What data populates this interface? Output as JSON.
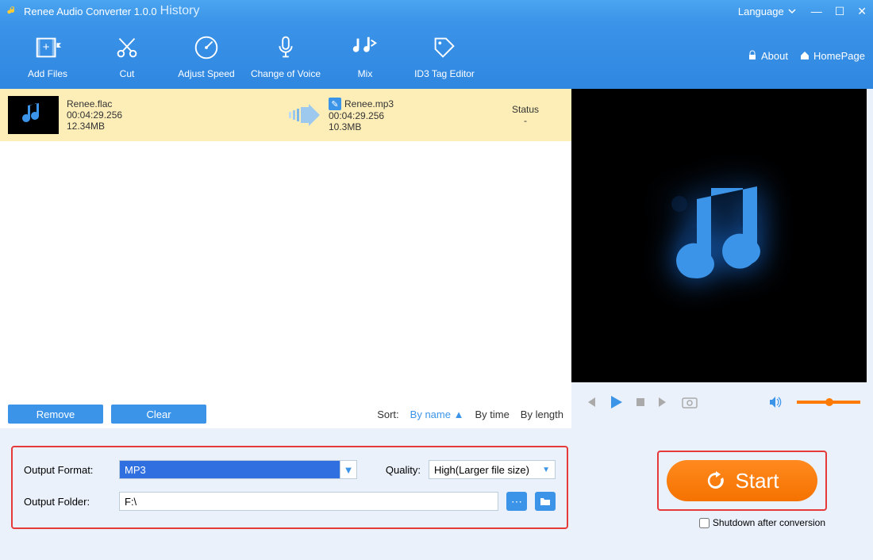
{
  "titlebar": {
    "app_title": "Renee Audio Converter 1.0.0",
    "history": "History",
    "language": "Language"
  },
  "toolbar": {
    "items": [
      {
        "label": "Add Files"
      },
      {
        "label": "Cut"
      },
      {
        "label": "Adjust Speed"
      },
      {
        "label": "Change of Voice"
      },
      {
        "label": "Mix"
      },
      {
        "label": "ID3 Tag Editor"
      }
    ],
    "about": "About",
    "homepage": "HomePage"
  },
  "filelist": {
    "items": [
      {
        "src_name": "Renee.flac",
        "src_duration": "00:04:29.256",
        "src_size": "12.34MB",
        "dst_name": "Renee.mp3",
        "dst_duration": "00:04:29.256",
        "dst_size": "10.3MB",
        "status_header": "Status",
        "status_value": "-"
      }
    ]
  },
  "listbottom": {
    "remove": "Remove",
    "clear": "Clear",
    "sort_label": "Sort:",
    "by_name": "By name",
    "by_time": "By time",
    "by_length": "By length"
  },
  "settings": {
    "output_format_label": "Output Format:",
    "output_format_value": "MP3",
    "quality_label": "Quality:",
    "quality_value": "High(Larger file size)",
    "output_folder_label": "Output Folder:",
    "output_folder_value": "F:\\"
  },
  "start": {
    "label": "Start"
  },
  "shutdown_label": "Shutdown after conversion"
}
